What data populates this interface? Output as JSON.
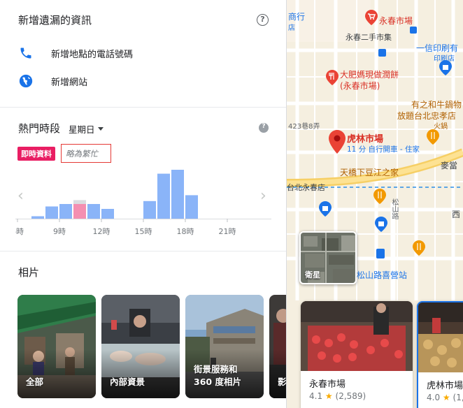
{
  "missing_info": {
    "title": "新增遺漏的資訊",
    "items": [
      {
        "icon": "phone-icon",
        "label": "新增地點的電話號碼"
      },
      {
        "icon": "globe-icon",
        "label": "新增網站"
      }
    ]
  },
  "popular_times": {
    "title": "熱門時段",
    "day": "星期日",
    "live_badge": "即時資料",
    "live_status": "略為繁忙",
    "chart_data": {
      "type": "bar",
      "categories": [
        "6時",
        "7時",
        "8時",
        "9時",
        "10時",
        "11時",
        "12時",
        "13時",
        "14時",
        "15時",
        "16時",
        "17時",
        "18時",
        "19時",
        "20時",
        "21時",
        "22時",
        "23時"
      ],
      "values": [
        0,
        5,
        25,
        30,
        30,
        30,
        20,
        0,
        0,
        36,
        92,
        100,
        48,
        0,
        0,
        0,
        0,
        0
      ],
      "live": {
        "category": "10時",
        "value": 38,
        "usual": 30
      },
      "tick_labels": [
        "6時",
        "9時",
        "12時",
        "15時",
        "18時",
        "21時"
      ],
      "colors": {
        "bar": "#8ab4f8",
        "live": "#f48fb1",
        "live_usual": "#dadce0"
      }
    }
  },
  "photos": {
    "title": "相片",
    "items": [
      {
        "label_lines": [
          "全部"
        ]
      },
      {
        "label_lines": [
          "內部資景"
        ]
      },
      {
        "label_lines": [
          "街景服務和",
          "360 度相片"
        ]
      },
      {
        "label_lines": [
          "影"
        ]
      }
    ]
  },
  "map": {
    "labels": {
      "l1": "商行",
      "l2": "店",
      "l3": "永春市場",
      "l4": "永春二手市集",
      "l5": "一信印刷有",
      "l6": "印刷店",
      "l7": "大肥媽現做潤餅",
      "l8": "(永春市場)",
      "l9": "有之和牛鍋物",
      "l10": "放題台北忠孝店",
      "l11": "火鍋",
      "l12": "423巷8弄",
      "l13": "虎林市場",
      "l14": "11 分 自行開車 - 住家",
      "l15": "天橋下豆江之家",
      "l16": "麥當",
      "l17": "台北永春店",
      "l18": "松山路",
      "l19": "西",
      "l20": "食郭",
      "l21": "松山路喜營站",
      "l22": "中山"
    },
    "sat_label": "衛星",
    "cards": [
      {
        "name": "永春市場",
        "rating": "4.1",
        "reviews": "(2,589)"
      },
      {
        "name": "虎林市場",
        "rating": "4.0",
        "reviews": "(1,3"
      }
    ]
  }
}
